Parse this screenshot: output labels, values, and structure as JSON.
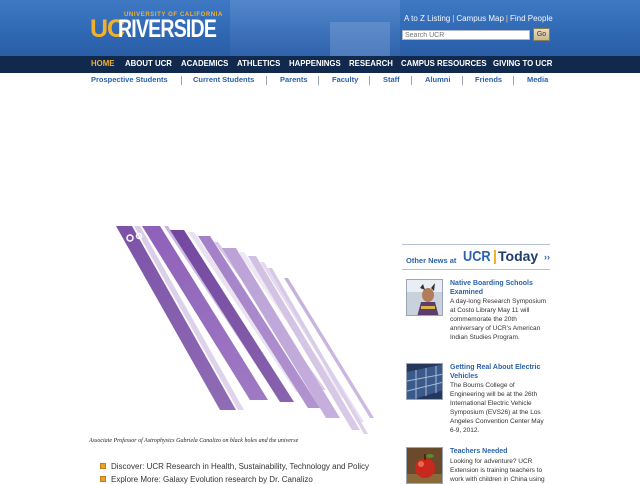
{
  "header": {
    "logo_uc": "UC",
    "logo_riverside": "RIVERSIDE",
    "logo_university": "UNIVERSITY OF CALIFORNIA",
    "utility_links": [
      "A to Z Listing",
      "Campus Map",
      "Find People"
    ],
    "search_placeholder": "Search UCR",
    "go_label": "Go"
  },
  "main_nav": [
    {
      "label": "HOME",
      "active": true
    },
    {
      "label": "ABOUT UCR",
      "active": false
    },
    {
      "label": "ACADEMICS",
      "active": false
    },
    {
      "label": "ATHLETICS",
      "active": false
    },
    {
      "label": "HAPPENINGS",
      "active": false
    },
    {
      "label": "RESEARCH",
      "active": false
    },
    {
      "label": "CAMPUS RESOURCES",
      "active": false
    },
    {
      "label": "GIVING TO UCR",
      "active": false
    }
  ],
  "audience_nav": [
    "Prospective Students",
    "Current Students",
    "Parents",
    "Faculty",
    "Staff",
    "Alumni",
    "Friends",
    "Media"
  ],
  "hero": {
    "caption": "Associate Professor of Astrophysics Gabriela Canalizo on black holes and the universe"
  },
  "discover_link": "Discover: UCR Research in Health, Sustainability, Technology and Policy",
  "explore_link": "Explore More: Galaxy Evolution research by Dr. Canalizo",
  "today": {
    "other_news": "Other News at",
    "ucr": "UCR",
    "today": "Today",
    "chevron": "››",
    "items": [
      {
        "title": "Native Boarding Schools Examined",
        "body": "A day-long Research Symposium at Costo Library May 11 will commemorate the 20th anniversary of UCR’s American Indian Studies Program."
      },
      {
        "title": "Getting Real About Electric Vehicles",
        "body": "The Bourns College of Engineering will be at the 26th International Electric Vehicle Symposium (EVS26) at the Los Angeles Convention Center May 6-9, 2012."
      },
      {
        "title": "Teachers Needed",
        "body": "Looking for adventure? UCR Extension is training teachers to work with children in China using"
      }
    ]
  },
  "colors": {
    "header_blue": "#2f67b3",
    "nav_navy": "#12294e",
    "accent_gold": "#f2b12d",
    "link_blue": "#2b62ab",
    "hero_purple": "#7a4fa6"
  }
}
